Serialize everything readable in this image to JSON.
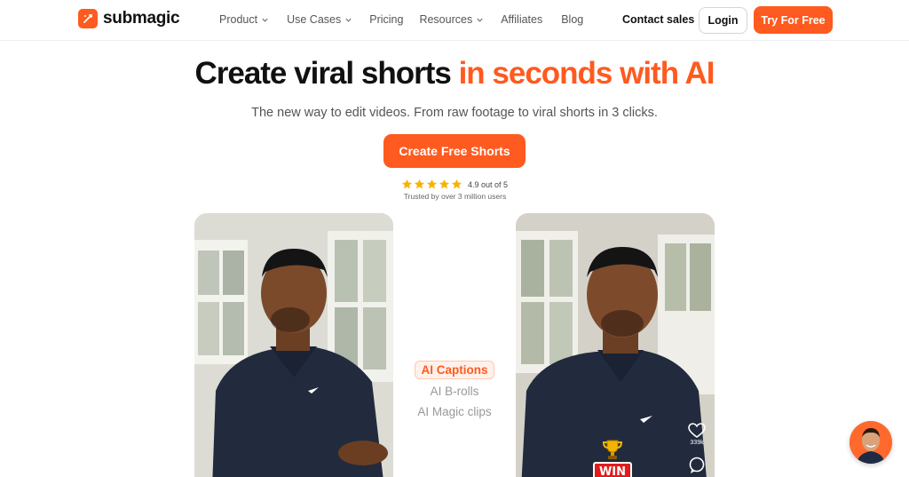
{
  "brand": {
    "name": "submagic",
    "accent": "#ff5a1f"
  },
  "nav": {
    "items": [
      {
        "label": "Product",
        "dropdown": true
      },
      {
        "label": "Use Cases",
        "dropdown": true
      },
      {
        "label": "Pricing",
        "dropdown": false
      },
      {
        "label": "Resources",
        "dropdown": true
      },
      {
        "label": "Affiliates",
        "dropdown": false
      },
      {
        "label": "Blog",
        "dropdown": false
      }
    ],
    "contact_label": "Contact sales",
    "login_label": "Login",
    "try_label": "Try For Free"
  },
  "hero": {
    "headline_main": "Create viral shorts",
    "headline_accent": "in seconds with AI",
    "subhead": "The new way to edit videos. From raw footage to viral shorts in 3 clicks.",
    "cta_label": "Create Free Shorts",
    "rating": {
      "stars": 5,
      "text": "4.9 out of 5",
      "trusted": "Trusted by over 3 million users"
    }
  },
  "features": [
    {
      "label": "AI Captions",
      "active": true
    },
    {
      "label": "AI B-rolls",
      "active": false
    },
    {
      "label": "AI Magic clips",
      "active": false
    }
  ],
  "video_overlay": {
    "like_count": "339k",
    "badge": "WIN"
  }
}
